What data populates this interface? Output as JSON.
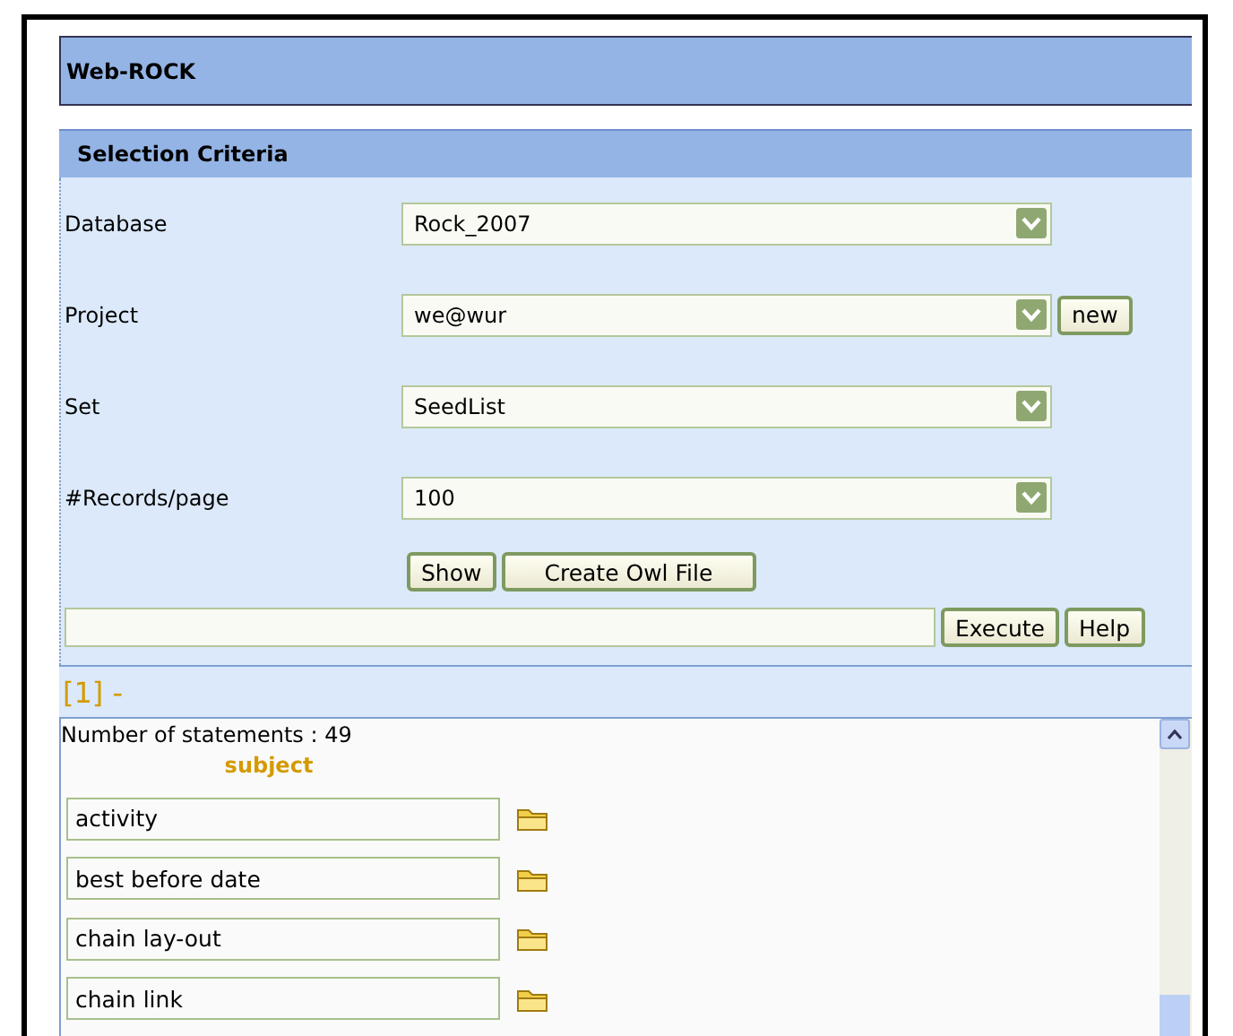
{
  "app_title": "Web-ROCK",
  "section_title": "Selection Criteria",
  "fields": [
    {
      "label": "Database",
      "value": "Rock_2007"
    },
    {
      "label": "Project",
      "value": "we@wur",
      "button": "new"
    },
    {
      "label": "Set",
      "value": "SeedList"
    },
    {
      "label": "#Records/page",
      "value": "100"
    }
  ],
  "buttons": [
    "Show",
    "Create Owl File"
  ],
  "query": {
    "buttons": [
      "Execute",
      "Help"
    ]
  },
  "page_marker": "[1] -",
  "results": {
    "count_text": "Number of statements : 49",
    "column": "subject",
    "items": [
      "activity",
      "best before date",
      "chain lay-out",
      "chain link"
    ]
  }
}
